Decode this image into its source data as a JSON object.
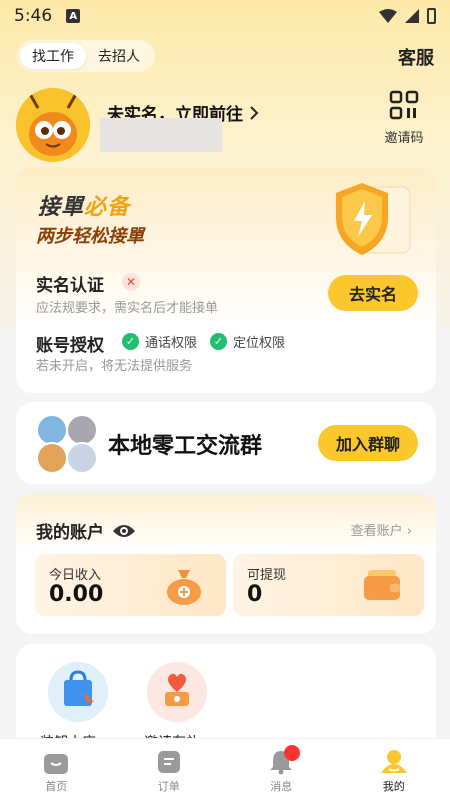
{
  "status_bar": {
    "time": "5:46",
    "indicator": "A"
  },
  "header": {
    "segments": [
      {
        "label": "找工作",
        "active": true
      },
      {
        "label": "去招人",
        "active": false
      }
    ],
    "service_label": "客服"
  },
  "profile": {
    "verify_prompt": "未实名，立即前往",
    "invite_label": "邀请码"
  },
  "cert_card": {
    "slogan_part1": "接單",
    "slogan_part2": "必备",
    "slogan_line2": "两步轻松接單",
    "realname_title": "实名认证",
    "realname_desc": "应法规要求，需实名后才能接单",
    "realname_button": "去实名",
    "auth_title": "账号授权",
    "permissions": [
      "通话权限",
      "定位权限"
    ],
    "auth_desc": "若未开启，将无法提供服务"
  },
  "group_card": {
    "title": "本地零工交流群",
    "button": "加入群聊"
  },
  "account_card": {
    "title": "我的账户",
    "view_link": "查看账户",
    "today_income_label": "今日收入",
    "today_income_value": "0.00",
    "withdrawable_label": "可提现",
    "withdrawable_value": "0"
  },
  "services": [
    "装卸小店",
    "邀请有礼"
  ],
  "tabbar": [
    {
      "label": "首页",
      "icon": "home-icon"
    },
    {
      "label": "订单",
      "icon": "order-icon"
    },
    {
      "label": "消息",
      "icon": "bell-icon"
    },
    {
      "label": "我的",
      "icon": "profile-icon",
      "active": true
    }
  ],
  "colors": {
    "accent": "#fbc72d",
    "success": "#1fbf6f",
    "danger": "#ee4b2b"
  }
}
